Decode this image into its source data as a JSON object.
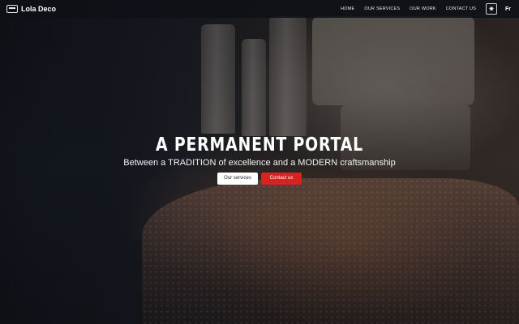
{
  "brand": {
    "name": "Lola Deco",
    "logo_icon": "monitor-icon"
  },
  "nav": {
    "links": [
      {
        "label": "HOME"
      },
      {
        "label": "OUR SERVICES"
      },
      {
        "label": "OUR WORK"
      },
      {
        "label": "CONTACT US"
      }
    ],
    "theme_toggle_icon": "sun-icon",
    "theme_toggle_glyph": "✷",
    "language": "Fr"
  },
  "hero": {
    "title": "A PERMANENT PORTAL",
    "subtitle": "Between a TRADITION of excellence and a MODERN craftsmanship",
    "buttons": {
      "services": "Our services",
      "contact": "Contact us"
    }
  },
  "colors": {
    "navbar_bg": "#0e1016",
    "accent_red": "#d82121",
    "text_white": "#ffffff"
  }
}
